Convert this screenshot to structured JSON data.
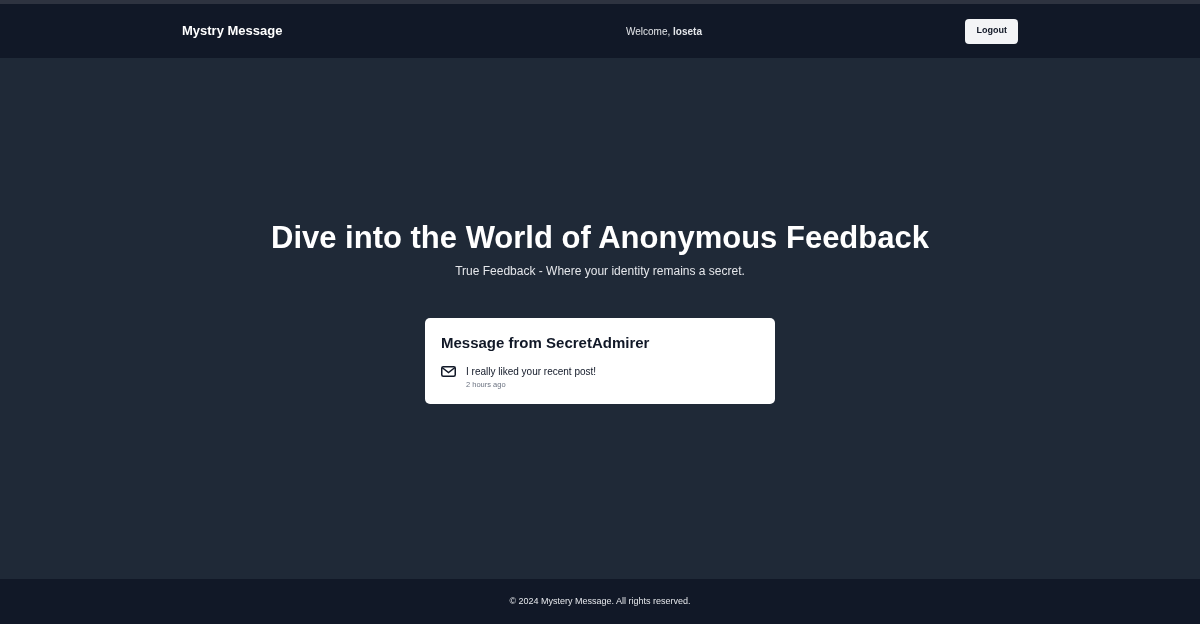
{
  "navbar": {
    "brand": "Mystry Message",
    "welcome": "Welcome, **loseta**",
    "logout_button": "Logout"
  },
  "hero": {
    "title": "Dive into the World of Anonymous Feedback",
    "subtitle": "True Feedback - Where your identity remains a secret."
  },
  "message_card": {
    "title": "Message from SecretAdmirer",
    "content": "I really liked your recent post!",
    "time": "2 hours ago"
  },
  "footer": {
    "text": "© 2024 Mystery Message. All rights reserved."
  }
}
